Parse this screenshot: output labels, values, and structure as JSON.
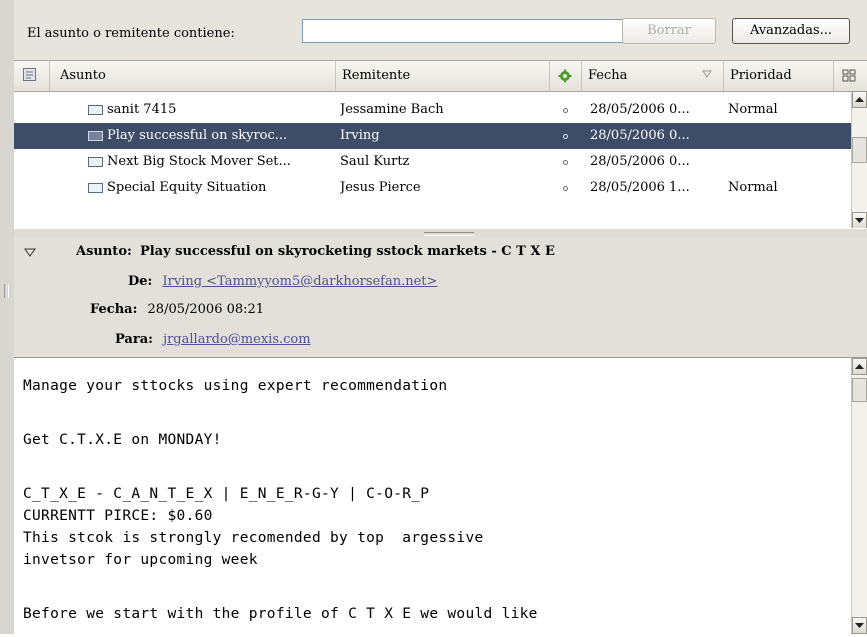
{
  "search": {
    "label": "El asunto o remitente contiene:",
    "value": "",
    "placeholder": "",
    "clear_label": "Borrar",
    "advanced_label": "Avanzadas..."
  },
  "columns": {
    "subject": "Asunto",
    "sender": "Remitente",
    "date": "Fecha",
    "priority": "Prioridad"
  },
  "messages": [
    {
      "subject": "sanit 7415",
      "sender": "Jessamine Bach",
      "date": "28/05/2006 0...",
      "priority": "Normal",
      "selected": false
    },
    {
      "subject": "Play successful on skyroc...",
      "sender": "Irving",
      "date": "28/05/2006 0...",
      "priority": "",
      "selected": true
    },
    {
      "subject": "Next Big Stock Mover Set...",
      "sender": "Saul Kurtz",
      "date": "28/05/2006 0...",
      "priority": "",
      "selected": false
    },
    {
      "subject": "Special Equity Situation",
      "sender": "Jesus Pierce",
      "date": "28/05/2006 1...",
      "priority": "Normal",
      "selected": false
    }
  ],
  "header": {
    "subject_label": "Asunto:",
    "subject": "Play successful on skyrocketing sstock markets - C T X E",
    "from_label": "De:",
    "from": "Irving <Tammyyom5@darkhorsefan.net>",
    "date_label": "Fecha:",
    "date": "28/05/2006 08:21",
    "to_label": "Para:",
    "to": "jrgallardo@mexis.com"
  },
  "body_lines": [
    "Manage your sttocks using expert recommendation",
    "",
    "Get C.T.X.E on MONDAY!",
    "",
    "C_T_X_E - C_A_N_T_E_X | E_N_E_R-G-Y | C-O-R_P",
    "CURRENTT PIRCE: $0.60",
    "This stcok is strongly recomended by top  argessive",
    "invetsor for upcoming week",
    "",
    "Before we start with the profile of C T X E we would like"
  ],
  "colors": {
    "selection": "#3d4d68",
    "link": "#4f4f9a",
    "panel": "#e2e0d8"
  },
  "icons": {
    "thread_column_picker": "thread-column-icon",
    "read_status": "green-gear-icon",
    "sort": "sort-descending-icon",
    "column_picker": "column-picker-icon",
    "message": "envelope-icon",
    "twisty": "twisty-down-icon"
  }
}
